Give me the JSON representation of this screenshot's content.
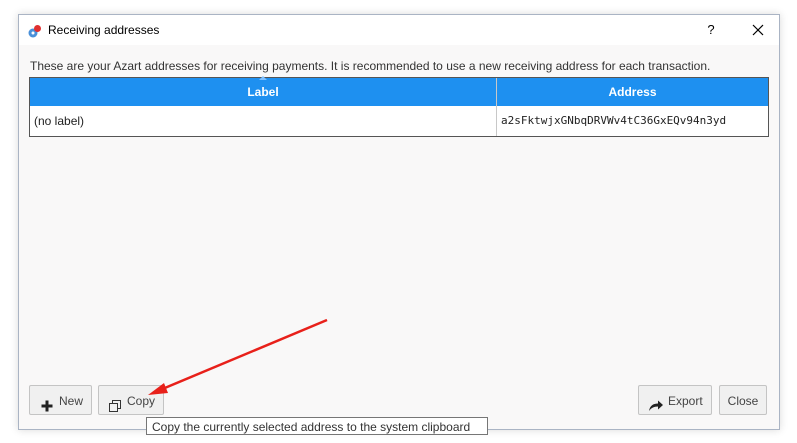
{
  "window": {
    "title": "Receiving addresses",
    "help_label": "?"
  },
  "description": "These are your Azart addresses for receiving payments. It is recommended to use a new receiving address for each transaction.",
  "table": {
    "columns": [
      "Label",
      "Address"
    ],
    "rows": [
      {
        "label": "(no label)",
        "address": "a2sFktwjxGNbqDRVWv4tC36GxEQv94n3yd"
      }
    ]
  },
  "buttons": {
    "new": "New",
    "copy": "Copy",
    "export": "Export",
    "close": "Close"
  },
  "tooltip": "Copy the currently selected address to the system clipboard",
  "colors": {
    "header": "#1e90f0",
    "annotation_arrow": "#e8201a"
  },
  "icons": {
    "app": "app-logo-icon",
    "new": "plus-icon",
    "copy": "copy-icon",
    "export": "export-arrow-icon"
  }
}
